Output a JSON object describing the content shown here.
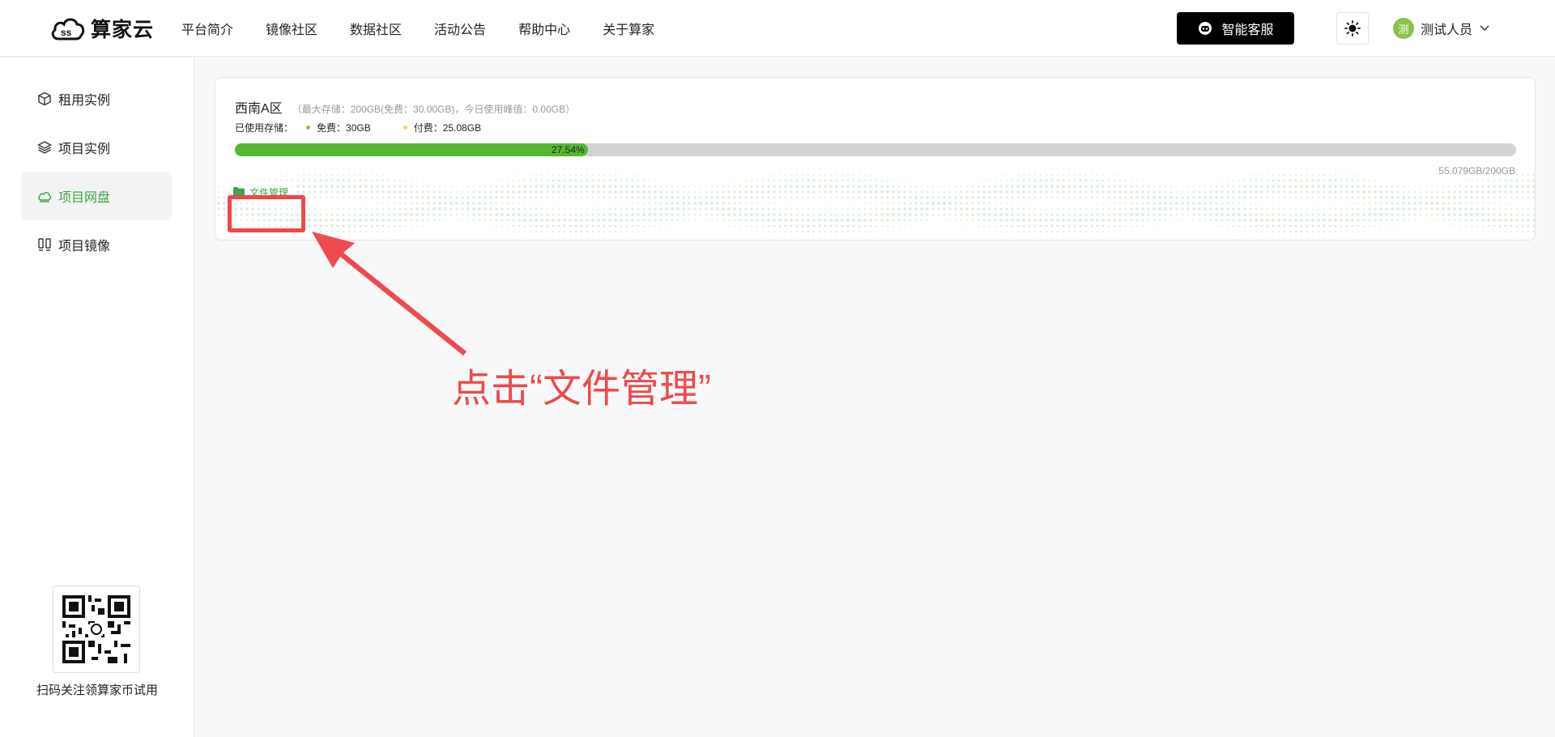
{
  "header": {
    "logo_text": "算家云",
    "nav": [
      "平台简介",
      "镜像社区",
      "数据社区",
      "活动公告",
      "帮助中心",
      "关于算家"
    ],
    "service_label": "智能客服",
    "service_icon": "robot-icon",
    "theme_icon": "sun-icon",
    "user": {
      "avatar_text": "测",
      "name": "测试人员"
    }
  },
  "sidebar": {
    "items": [
      {
        "label": "租用实例",
        "icon": "cube-icon",
        "active": false
      },
      {
        "label": "项目实例",
        "icon": "layers-icon",
        "active": false
      },
      {
        "label": "项目网盘",
        "icon": "cloud-icon",
        "active": true
      },
      {
        "label": "项目镜像",
        "icon": "mirror-icon",
        "active": false
      }
    ],
    "qr_caption": "扫码关注领算家币试用"
  },
  "storage": {
    "region": "西南A区",
    "meta": "（最大存储：200GB(免费：30.00GB)，今日使用峰值：0.00GB）",
    "used_label": "已使用存储：",
    "free_label": "免费：30GB",
    "paid_label": "付费：25.08GB",
    "free_color": "#8bc34a",
    "paid_color": "#ffd54f",
    "percent": 27.54,
    "percent_label": "27.54%",
    "total_label": "55.079GB/200GB",
    "file_button": "文件管理"
  },
  "annotation": {
    "text": "点击“文件管理”",
    "color": "#ee4a4c"
  }
}
